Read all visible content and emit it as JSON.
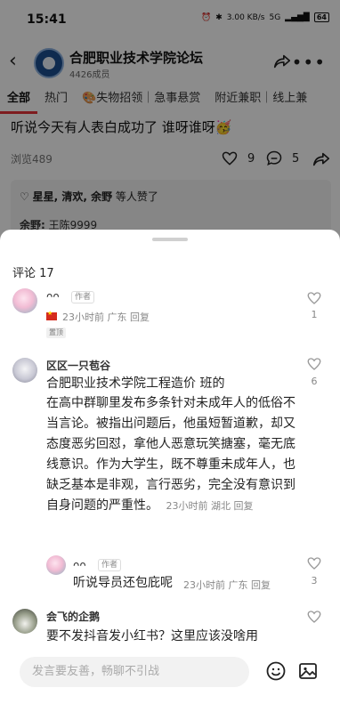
{
  "status_bar": {
    "time": "15:41",
    "network": "3.00 KB/s",
    "signal": "5G",
    "battery": "64"
  },
  "header": {
    "forum_name": "合肥职业技术学院论坛",
    "members": "4426成员"
  },
  "tabs": [
    "全部",
    "热门",
    "🎨失物招领｜急事悬赏",
    "附近兼职｜线上兼"
  ],
  "post": {
    "title": "听说今天有人表白成功了 谁呀谁呀🥳",
    "views": "浏览489",
    "likes": "9",
    "comments": "5",
    "likers_names": "星星, 清欢, 余野",
    "likers_suffix": "等人赞了",
    "reply_preview_name": "余野:",
    "reply_preview_text": "王陈9999"
  },
  "comments_sheet": {
    "title": "评论 17",
    "comments": [
      {
        "name": "ᴖᴖ",
        "tag": "作者",
        "meta": "23小时前 广东 回复",
        "badge": "置顶",
        "likes": "1"
      },
      {
        "name": "区区一只苞谷",
        "text_l1": "合肥职业技术学院工程造价 班的",
        "text_body": "在高中群聊里发布多条针对未成年人的低俗不当言论。被指出问题后，他虽短暂道歉，却又态度恶劣回怼，拿他人恶意玩笑搪塞，毫无底线意识。作为大学生，既不尊重未成年人，也缺乏基本是非观，言行恶劣，完全没有意识到自身问题的严重性。",
        "meta": "23小时前 湖北 回复",
        "likes": "6"
      },
      {
        "name": "ᴖᴖ",
        "tag": "作者",
        "text": "听说导员还包庇呢",
        "meta": "23小时前 广东 回复",
        "likes": "3"
      },
      {
        "name": "会飞的企鹅",
        "text": "要不发抖音发小红书？这里应该没啥用",
        "likes": ""
      }
    ]
  },
  "input": {
    "placeholder": "发言要友善，畅聊不引战"
  }
}
